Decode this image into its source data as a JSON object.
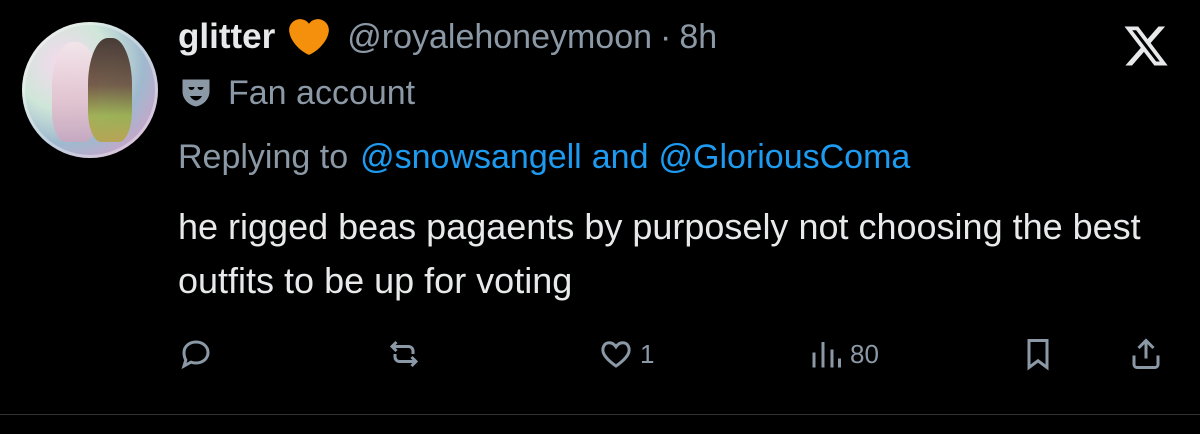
{
  "author": {
    "display_name": "glitter",
    "badge_icon": "orange-heart-icon",
    "handle": "@royalehoneymoon",
    "separator": "·",
    "time_ago": "8h",
    "label_icon": "theater-mask-icon",
    "label": "Fan account"
  },
  "reply": {
    "prefix": "Replying to",
    "mention_1": "@snowsangell",
    "conjunction": "and",
    "mention_2": "@GloriousComa"
  },
  "tweet": {
    "text": "he rigged beas pagaents by purposely not choosing the best outfits to be up for voting"
  },
  "actions": {
    "reply_count": "",
    "retweet_count": "",
    "like_count": "1",
    "views_count": "80"
  },
  "colors": {
    "background": "#000000",
    "text_primary": "#e7e9ea",
    "text_secondary": "#8b98a5",
    "link": "#1d9bf0",
    "heart": "#f4900c"
  }
}
